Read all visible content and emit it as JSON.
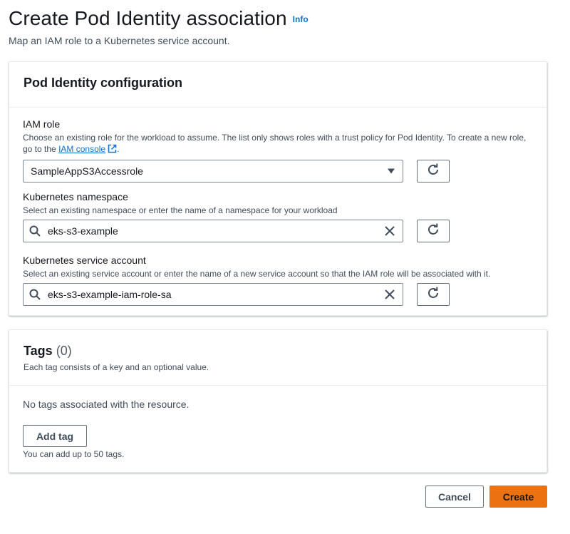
{
  "header": {
    "title": "Create Pod Identity association",
    "info_link": "Info",
    "subtitle": "Map an IAM role to a Kubernetes service account."
  },
  "config": {
    "title": "Pod Identity configuration",
    "iam_role": {
      "label": "IAM role",
      "description": "Choose an existing role for the workload to assume. The list only shows roles with a trust policy for Pod Identity. To create a new role, go to the",
      "link_text": "IAM console",
      "after_link": ".",
      "value": "SampleAppS3Accessrole"
    },
    "namespace": {
      "label": "Kubernetes namespace",
      "description": "Select an existing namespace or enter the name of a namespace for your workload",
      "value": "eks-s3-example"
    },
    "service_account": {
      "label": "Kubernetes service account",
      "description": "Select an existing service account or enter the name of a new service account so that the IAM role will be associated with it.",
      "value": "eks-s3-example-iam-role-sa"
    }
  },
  "tags": {
    "title": "Tags",
    "count": "(0)",
    "description": "Each tag consists of a key and an optional value.",
    "empty_text": "No tags associated with the resource.",
    "add_button": "Add tag",
    "limit_text": "You can add up to 50 tags."
  },
  "footer": {
    "cancel": "Cancel",
    "create": "Create"
  },
  "colors": {
    "primary": "#ec7211",
    "link": "#0972d3",
    "text": "#16191f",
    "secondary_text": "#414d5c"
  }
}
